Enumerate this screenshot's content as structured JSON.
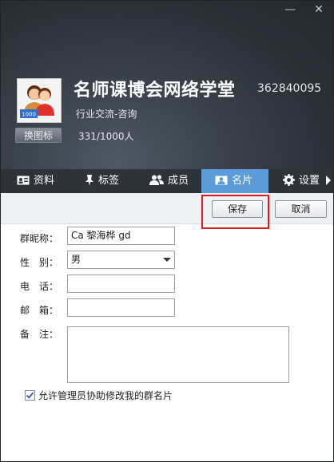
{
  "window": {
    "minimize_glyph": "—",
    "close_glyph": "✕"
  },
  "group": {
    "avatar_badge": "1000",
    "change_icon_label": "换图标",
    "name": "名师课博会网络学堂",
    "id": "362840095",
    "category": "行业交流-咨询",
    "members": "331/1000人"
  },
  "tabs": [
    {
      "label": "资料",
      "icon": "id-card-icon"
    },
    {
      "label": "标签",
      "icon": "pin-icon"
    },
    {
      "label": "成员",
      "icon": "members-icon"
    },
    {
      "label": "名片",
      "icon": "card-icon",
      "active": true
    },
    {
      "label": "设置",
      "icon": "gear-icon"
    }
  ],
  "toolbar": {
    "save_label": "保存",
    "cancel_label": "取消"
  },
  "form": {
    "nickname_label": "群昵称：",
    "nickname_value": "Ca 黎海桦 gd",
    "gender_label": "性　别：",
    "gender_value": "男",
    "phone_label": "电　话：",
    "phone_value": "",
    "email_label": "邮　箱：",
    "email_value": "",
    "note_label": "备　注：",
    "note_value": "",
    "allow_admin_label": "允许管理员协助修改我的群名片",
    "allow_admin_checked": true
  },
  "colors": {
    "accent": "#5a9bd8",
    "highlight": "#e0191b",
    "header_bg": "#2e3339"
  }
}
